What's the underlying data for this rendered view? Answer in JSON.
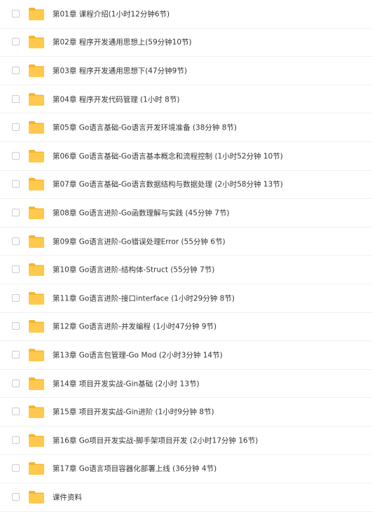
{
  "folder_color": "#ffc94d",
  "folder_tab_color": "#f7b52c",
  "items": [
    {
      "name": "第01章 课程介绍(1小时12分钟6节)",
      "icon": "folder-icon"
    },
    {
      "name": "第02章 程序开发通用思想上(59分钟10节)",
      "icon": "folder-icon"
    },
    {
      "name": "第03章 程序开发通用思想下(47分钟9节)",
      "icon": "folder-icon"
    },
    {
      "name": "第04章 程序开发代码管理 (1小时 8节)",
      "icon": "folder-icon"
    },
    {
      "name": "第05章 Go语言基础-Go语言开发环境准备 (38分钟 8节)",
      "icon": "folder-icon"
    },
    {
      "name": "第06章 Go语言基础-Go语言基本概念和流程控制 (1小时52分钟 10节)",
      "icon": "folder-icon"
    },
    {
      "name": "第07章 Go语言基础-Go语言数据结构与数据处理 (2小时58分钟 13节)",
      "icon": "folder-icon"
    },
    {
      "name": "第08章 Go语言进阶-Go函数理解与实践 (45分钟 7节)",
      "icon": "folder-icon"
    },
    {
      "name": "第09章 Go语言进阶-Go错误处理Error (55分钟 6节)",
      "icon": "folder-icon"
    },
    {
      "name": "第10章 Go语言进阶-结构体-Struct (55分钟 7节)",
      "icon": "folder-icon"
    },
    {
      "name": "第11章 Go语言进阶-接口interface (1小时29分钟 8节)",
      "icon": "folder-icon"
    },
    {
      "name": "第12章 Go语言进阶-并发编程 (1小时47分钟 9节)",
      "icon": "folder-icon"
    },
    {
      "name": "第13章 Go语言包管理-Go Mod (2小时3分钟 14节)",
      "icon": "folder-icon"
    },
    {
      "name": "第14章 项目开发实战-Gin基础 (2小时 13节)",
      "icon": "folder-icon"
    },
    {
      "name": "第15章 项目开发实战-Gin进阶 (1小时9分钟 8节)",
      "icon": "folder-icon"
    },
    {
      "name": "第16章 Go项目开发实战-脚手架项目开发 (2小时17分钟 16节)",
      "icon": "folder-icon"
    },
    {
      "name": "第17章 Go语言项目容器化部署上线 (36分钟 4节)",
      "icon": "folder-icon"
    },
    {
      "name": "课件资料",
      "icon": "folder-icon"
    }
  ]
}
